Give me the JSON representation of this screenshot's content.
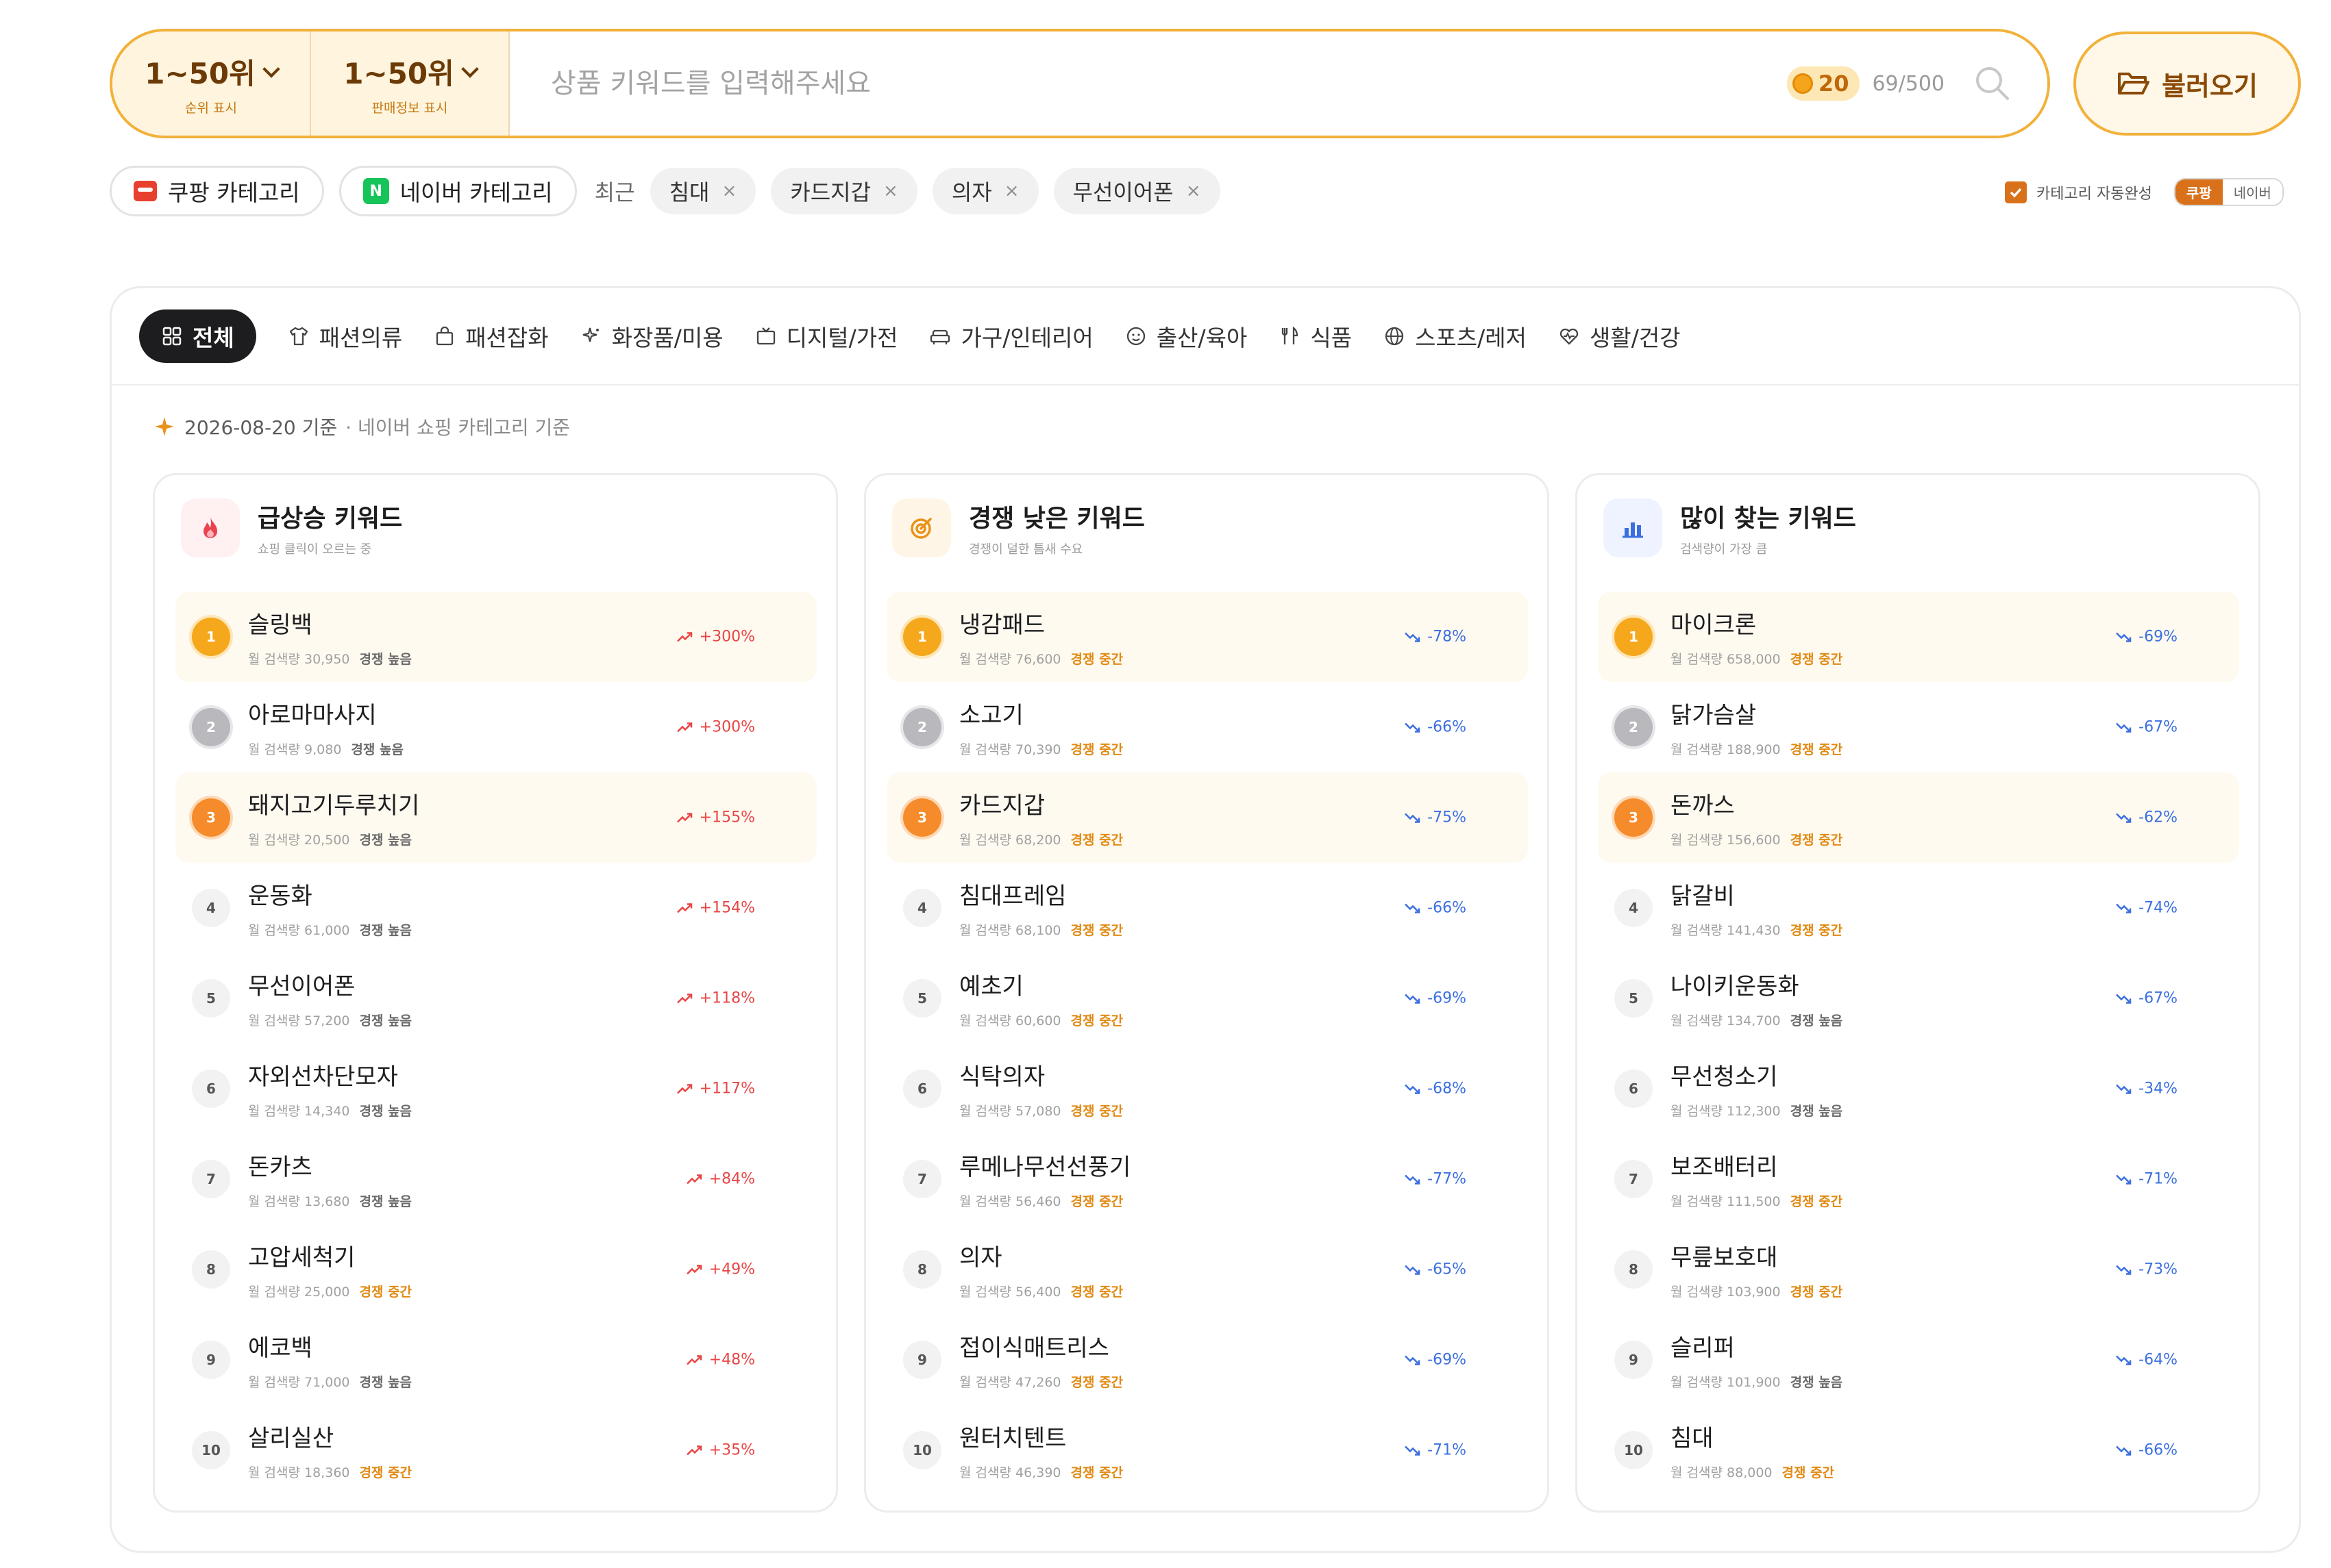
{
  "search": {
    "rank_display": {
      "value": "1~50위",
      "label": "순위 표시"
    },
    "sales_display": {
      "value": "1~50위",
      "label": "판매정보 표시"
    },
    "placeholder": "상품 키워드를 입력해주세요",
    "credits": "20",
    "usage": "69/500",
    "load_button": "불러오기"
  },
  "chips": {
    "coupang_category": "쿠팡 카테고리",
    "naver_category": "네이버 카테고리",
    "naver_badge": "N",
    "recent_label": "최근",
    "recent": [
      "침대",
      "카드지갑",
      "의자",
      "무선이어폰"
    ],
    "close_glyph": "×"
  },
  "auto_complete": {
    "label": "카테고리 자동완성",
    "options": [
      "쿠팡",
      "네이버"
    ],
    "selected": "쿠팡",
    "checked": true
  },
  "tabs": [
    {
      "label": "전체",
      "icon": "grid-icon",
      "active": true
    },
    {
      "label": "패션의류",
      "icon": "shirt-icon"
    },
    {
      "label": "패션잡화",
      "icon": "bag-icon"
    },
    {
      "label": "화장품/미용",
      "icon": "sparkle-icon"
    },
    {
      "label": "디지털/가전",
      "icon": "tv-icon"
    },
    {
      "label": "가구/인테리어",
      "icon": "sofa-icon"
    },
    {
      "label": "출산/육아",
      "icon": "baby-icon"
    },
    {
      "label": "식품",
      "icon": "utensils-icon"
    },
    {
      "label": "스포츠/레저",
      "icon": "globe-icon"
    },
    {
      "label": "생활/건강",
      "icon": "heart-pulse-icon"
    }
  ],
  "date_line": {
    "date": "2026-08-20 기준",
    "source": "· 네이버 쇼핑 카테고리 기준"
  },
  "meta_prefix": "월 검색량",
  "columns": [
    {
      "title": "급상승 키워드",
      "subtitle": "쇼핑 클릭이 오르는 중",
      "icon": "flame-icon",
      "accent": "#e9424f",
      "items": [
        {
          "rank": "1",
          "name": "슬링백",
          "volume": "30,950",
          "competition": "경쟁 높음",
          "change": "+300%"
        },
        {
          "rank": "2",
          "name": "아로마마사지",
          "volume": "9,080",
          "competition": "경쟁 높음",
          "change": "+300%"
        },
        {
          "rank": "3",
          "name": "돼지고기두루치기",
          "volume": "20,500",
          "competition": "경쟁 높음",
          "change": "+155%"
        },
        {
          "rank": "4",
          "name": "운동화",
          "volume": "61,000",
          "competition": "경쟁 높음",
          "change": "+154%"
        },
        {
          "rank": "5",
          "name": "무선이어폰",
          "volume": "57,200",
          "competition": "경쟁 높음",
          "change": "+118%"
        },
        {
          "rank": "6",
          "name": "자외선차단모자",
          "volume": "14,340",
          "competition": "경쟁 높음",
          "change": "+117%"
        },
        {
          "rank": "7",
          "name": "돈카츠",
          "volume": "13,680",
          "competition": "경쟁 높음",
          "change": "+84%"
        },
        {
          "rank": "8",
          "name": "고압세척기",
          "volume": "25,000",
          "competition": "경쟁 중간",
          "change": "+49%"
        },
        {
          "rank": "9",
          "name": "에코백",
          "volume": "71,000",
          "competition": "경쟁 높음",
          "change": "+48%"
        },
        {
          "rank": "10",
          "name": "살리실산",
          "volume": "18,360",
          "competition": "경쟁 중간",
          "change": "+35%"
        }
      ]
    },
    {
      "title": "경쟁 낮은 키워드",
      "subtitle": "경쟁이 덜한 틈새 수요",
      "icon": "target-icon",
      "accent": "#e8931a",
      "items": [
        {
          "rank": "1",
          "name": "냉감패드",
          "volume": "76,600",
          "competition": "경쟁 중간",
          "change": "-78%"
        },
        {
          "rank": "2",
          "name": "소고기",
          "volume": "70,390",
          "competition": "경쟁 중간",
          "change": "-66%"
        },
        {
          "rank": "3",
          "name": "카드지갑",
          "volume": "68,200",
          "competition": "경쟁 중간",
          "change": "-75%"
        },
        {
          "rank": "4",
          "name": "침대프레임",
          "volume": "68,100",
          "competition": "경쟁 중간",
          "change": "-66%"
        },
        {
          "rank": "5",
          "name": "예초기",
          "volume": "60,600",
          "competition": "경쟁 중간",
          "change": "-69%"
        },
        {
          "rank": "6",
          "name": "식탁의자",
          "volume": "57,080",
          "competition": "경쟁 중간",
          "change": "-68%"
        },
        {
          "rank": "7",
          "name": "루메나무선선풍기",
          "volume": "56,460",
          "competition": "경쟁 중간",
          "change": "-77%"
        },
        {
          "rank": "8",
          "name": "의자",
          "volume": "56,400",
          "competition": "경쟁 중간",
          "change": "-65%"
        },
        {
          "rank": "9",
          "name": "접이식매트리스",
          "volume": "47,260",
          "competition": "경쟁 중간",
          "change": "-69%"
        },
        {
          "rank": "10",
          "name": "원터치텐트",
          "volume": "46,390",
          "competition": "경쟁 중간",
          "change": "-71%"
        }
      ]
    },
    {
      "title": "많이 찾는 키워드",
      "subtitle": "검색량이 가장 큼",
      "icon": "bar-chart-icon",
      "accent": "#3b6fe0",
      "items": [
        {
          "rank": "1",
          "name": "마이크론",
          "volume": "658,000",
          "competition": "경쟁 중간",
          "change": "-69%"
        },
        {
          "rank": "2",
          "name": "닭가슴살",
          "volume": "188,900",
          "competition": "경쟁 중간",
          "change": "-67%"
        },
        {
          "rank": "3",
          "name": "돈까스",
          "volume": "156,600",
          "competition": "경쟁 중간",
          "change": "-62%"
        },
        {
          "rank": "4",
          "name": "닭갈비",
          "volume": "141,430",
          "competition": "경쟁 중간",
          "change": "-74%"
        },
        {
          "rank": "5",
          "name": "나이키운동화",
          "volume": "134,700",
          "competition": "경쟁 높음",
          "change": "-67%"
        },
        {
          "rank": "6",
          "name": "무선청소기",
          "volume": "112,300",
          "competition": "경쟁 높음",
          "change": "-34%"
        },
        {
          "rank": "7",
          "name": "보조배터리",
          "volume": "111,500",
          "competition": "경쟁 중간",
          "change": "-71%"
        },
        {
          "rank": "8",
          "name": "무릎보호대",
          "volume": "103,900",
          "competition": "경쟁 중간",
          "change": "-73%"
        },
        {
          "rank": "9",
          "name": "슬리퍼",
          "volume": "101,900",
          "competition": "경쟁 높음",
          "change": "-64%"
        },
        {
          "rank": "10",
          "name": "침대",
          "volume": "88,000",
          "competition": "경쟁 중간",
          "change": "-66%"
        }
      ]
    }
  ],
  "colors": {
    "accent": "#f2b13a",
    "up": "#e94545",
    "down": "#3b6fe0",
    "mid": "#e18a14"
  }
}
